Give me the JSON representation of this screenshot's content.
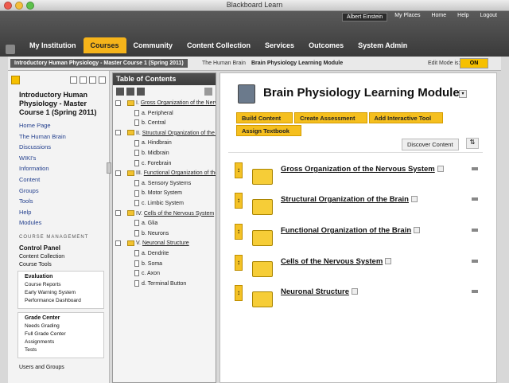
{
  "window": {
    "title": "Blackboard Learn"
  },
  "user_links": {
    "user": "Albert Einstein",
    "my_places": "My Places",
    "home": "Home",
    "help": "Help",
    "logout": "Logout"
  },
  "nav": {
    "tabs": [
      "My Institution",
      "Courses",
      "Community",
      "Content Collection",
      "Services",
      "Outcomes",
      "System Admin"
    ],
    "active": "Courses"
  },
  "breadcrumb": {
    "course": "Introductory Human Physiology - Master Course 1 (Spring 2011)",
    "level2": "The Human Brain",
    "level3": "Brain Physiology Learning Module"
  },
  "edit_mode": {
    "label": "Edit Mode is:",
    "state": "ON"
  },
  "course_menu": {
    "title": "Introductory Human Physiology - Master Course 1 (Spring 2011)",
    "items": [
      "Home Page",
      "The Human Brain",
      "Discussions",
      "WIKI's",
      "Information",
      "Content",
      "Groups",
      "Tools",
      "Help",
      "Modules"
    ]
  },
  "course_management": {
    "label": "COURSE MANAGEMENT",
    "control_panel": "Control Panel",
    "content_collection": "Content Collection",
    "course_tools": "Course Tools",
    "evaluation": {
      "title": "Evaluation",
      "items": [
        "Course Reports",
        "Early Warning System",
        "Performance Dashboard"
      ]
    },
    "grade_center": {
      "title": "Grade Center",
      "items": [
        "Needs Grading",
        "Full Grade Center",
        "Assignments",
        "Tests"
      ]
    },
    "users_groups": "Users and Groups"
  },
  "toc": {
    "title": "Table of Contents",
    "sections": [
      {
        "label": "I.",
        "title": "Gross Organization of the Nervous System",
        "subs": [
          "a. Peripheral",
          "b. Central"
        ]
      },
      {
        "label": "II.",
        "title": "Structural Organization of the Brain",
        "subs": [
          "a. Hindbrain",
          "b. Midbrain",
          "c. Forebrain"
        ]
      },
      {
        "label": "III.",
        "title": "Functional Organization of the Brain",
        "subs": [
          "a. Sensory Systems",
          "b. Motor System",
          "c. Limbic System"
        ]
      },
      {
        "label": "IV.",
        "title": "Cells of the Nervous System",
        "subs": [
          "a. Glia",
          "b. Neurons"
        ]
      },
      {
        "label": "V.",
        "title": "Neuronal Structure",
        "subs": [
          "a. Dendrite",
          "b. Soma",
          "c. Axon",
          "d. Terminal Button"
        ]
      }
    ]
  },
  "module": {
    "title": "Brain Physiology Learning Module",
    "actions": [
      "Build Content",
      "Create Assessment",
      "Add Interactive Tool",
      "Assign Textbook"
    ],
    "discover": "Discover Content",
    "items": [
      "Gross Organization of the Nervous System",
      "Structural Organization of the Brain",
      "Functional Organization of the Brain",
      "Cells of the Nervous System",
      "Neuronal Structure"
    ]
  },
  "colors": {
    "accent": "#f6b41a",
    "header": "#3a3a3a",
    "link": "#24408e"
  }
}
